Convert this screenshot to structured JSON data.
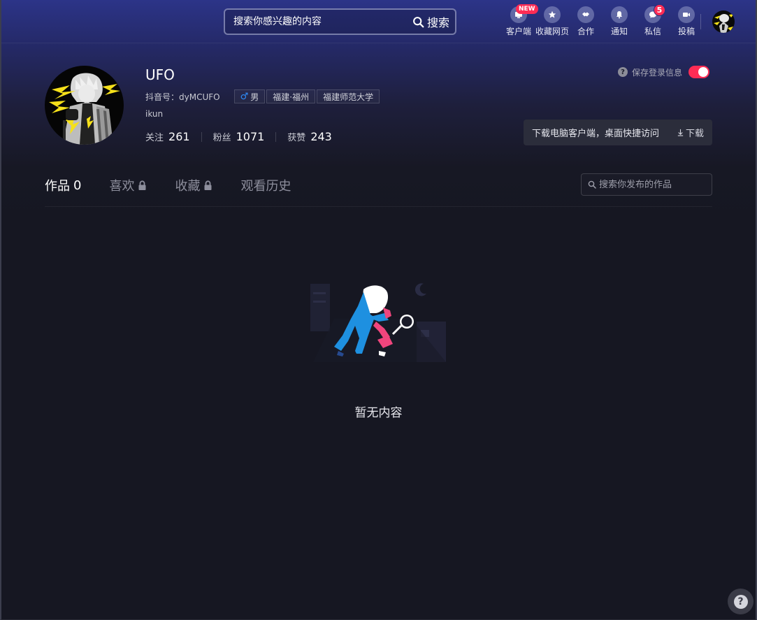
{
  "header": {
    "search_placeholder": "搜索你感兴趣的内容",
    "search_button": "搜索",
    "nav": [
      {
        "label": "客户端",
        "icon": "client-icon",
        "badge": "NEW"
      },
      {
        "label": "收藏网页",
        "icon": "star-icon"
      },
      {
        "label": "合作",
        "icon": "handshake-icon"
      },
      {
        "label": "通知",
        "icon": "bell-icon"
      },
      {
        "label": "私信",
        "icon": "message-icon",
        "badge": "5"
      },
      {
        "label": "投稿",
        "icon": "upload-video-icon"
      }
    ]
  },
  "profile": {
    "nickname": "UFO",
    "account_id": "抖音号：dyMCUFO",
    "gender_symbol": "♂",
    "gender": "男",
    "location": "福建·福州",
    "school": "福建师范大学",
    "signature": "ikun",
    "stats": [
      {
        "label": "关注",
        "value": "261"
      },
      {
        "label": "粉丝",
        "value": "1071"
      },
      {
        "label": "获赞",
        "value": "243"
      }
    ]
  },
  "save_login": {
    "label": "保存登录信息",
    "enabled": true
  },
  "download_banner": {
    "message": "下载电脑客户端，桌面快捷访问",
    "button": "下载"
  },
  "tabs": [
    {
      "label": "作品",
      "count": "0",
      "locked": false,
      "active": true
    },
    {
      "label": "喜欢",
      "locked": true,
      "active": false
    },
    {
      "label": "收藏",
      "locked": true,
      "active": false
    },
    {
      "label": "观看历史",
      "locked": false,
      "active": false
    }
  ],
  "works_search_placeholder": "搜索你发布的作品",
  "empty_text": "暂无内容",
  "colors": {
    "accent": "#fe2c55",
    "background": "#161722",
    "illustration_blue": "#1e90e0"
  }
}
